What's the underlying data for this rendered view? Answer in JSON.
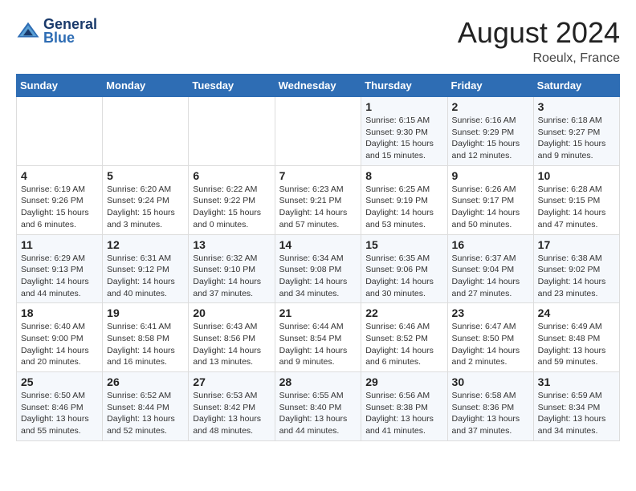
{
  "header": {
    "logo_line1": "General",
    "logo_line2": "Blue",
    "main_title": "August 2024",
    "subtitle": "Roeulx, France"
  },
  "days_of_week": [
    "Sunday",
    "Monday",
    "Tuesday",
    "Wednesday",
    "Thursday",
    "Friday",
    "Saturday"
  ],
  "weeks": [
    [
      {
        "day": "",
        "info": ""
      },
      {
        "day": "",
        "info": ""
      },
      {
        "day": "",
        "info": ""
      },
      {
        "day": "",
        "info": ""
      },
      {
        "day": "1",
        "info": "Sunrise: 6:15 AM\nSunset: 9:30 PM\nDaylight: 15 hours\nand 15 minutes."
      },
      {
        "day": "2",
        "info": "Sunrise: 6:16 AM\nSunset: 9:29 PM\nDaylight: 15 hours\nand 12 minutes."
      },
      {
        "day": "3",
        "info": "Sunrise: 6:18 AM\nSunset: 9:27 PM\nDaylight: 15 hours\nand 9 minutes."
      }
    ],
    [
      {
        "day": "4",
        "info": "Sunrise: 6:19 AM\nSunset: 9:26 PM\nDaylight: 15 hours\nand 6 minutes."
      },
      {
        "day": "5",
        "info": "Sunrise: 6:20 AM\nSunset: 9:24 PM\nDaylight: 15 hours\nand 3 minutes."
      },
      {
        "day": "6",
        "info": "Sunrise: 6:22 AM\nSunset: 9:22 PM\nDaylight: 15 hours\nand 0 minutes."
      },
      {
        "day": "7",
        "info": "Sunrise: 6:23 AM\nSunset: 9:21 PM\nDaylight: 14 hours\nand 57 minutes."
      },
      {
        "day": "8",
        "info": "Sunrise: 6:25 AM\nSunset: 9:19 PM\nDaylight: 14 hours\nand 53 minutes."
      },
      {
        "day": "9",
        "info": "Sunrise: 6:26 AM\nSunset: 9:17 PM\nDaylight: 14 hours\nand 50 minutes."
      },
      {
        "day": "10",
        "info": "Sunrise: 6:28 AM\nSunset: 9:15 PM\nDaylight: 14 hours\nand 47 minutes."
      }
    ],
    [
      {
        "day": "11",
        "info": "Sunrise: 6:29 AM\nSunset: 9:13 PM\nDaylight: 14 hours\nand 44 minutes."
      },
      {
        "day": "12",
        "info": "Sunrise: 6:31 AM\nSunset: 9:12 PM\nDaylight: 14 hours\nand 40 minutes."
      },
      {
        "day": "13",
        "info": "Sunrise: 6:32 AM\nSunset: 9:10 PM\nDaylight: 14 hours\nand 37 minutes."
      },
      {
        "day": "14",
        "info": "Sunrise: 6:34 AM\nSunset: 9:08 PM\nDaylight: 14 hours\nand 34 minutes."
      },
      {
        "day": "15",
        "info": "Sunrise: 6:35 AM\nSunset: 9:06 PM\nDaylight: 14 hours\nand 30 minutes."
      },
      {
        "day": "16",
        "info": "Sunrise: 6:37 AM\nSunset: 9:04 PM\nDaylight: 14 hours\nand 27 minutes."
      },
      {
        "day": "17",
        "info": "Sunrise: 6:38 AM\nSunset: 9:02 PM\nDaylight: 14 hours\nand 23 minutes."
      }
    ],
    [
      {
        "day": "18",
        "info": "Sunrise: 6:40 AM\nSunset: 9:00 PM\nDaylight: 14 hours\nand 20 minutes."
      },
      {
        "day": "19",
        "info": "Sunrise: 6:41 AM\nSunset: 8:58 PM\nDaylight: 14 hours\nand 16 minutes."
      },
      {
        "day": "20",
        "info": "Sunrise: 6:43 AM\nSunset: 8:56 PM\nDaylight: 14 hours\nand 13 minutes."
      },
      {
        "day": "21",
        "info": "Sunrise: 6:44 AM\nSunset: 8:54 PM\nDaylight: 14 hours\nand 9 minutes."
      },
      {
        "day": "22",
        "info": "Sunrise: 6:46 AM\nSunset: 8:52 PM\nDaylight: 14 hours\nand 6 minutes."
      },
      {
        "day": "23",
        "info": "Sunrise: 6:47 AM\nSunset: 8:50 PM\nDaylight: 14 hours\nand 2 minutes."
      },
      {
        "day": "24",
        "info": "Sunrise: 6:49 AM\nSunset: 8:48 PM\nDaylight: 13 hours\nand 59 minutes."
      }
    ],
    [
      {
        "day": "25",
        "info": "Sunrise: 6:50 AM\nSunset: 8:46 PM\nDaylight: 13 hours\nand 55 minutes."
      },
      {
        "day": "26",
        "info": "Sunrise: 6:52 AM\nSunset: 8:44 PM\nDaylight: 13 hours\nand 52 minutes."
      },
      {
        "day": "27",
        "info": "Sunrise: 6:53 AM\nSunset: 8:42 PM\nDaylight: 13 hours\nand 48 minutes."
      },
      {
        "day": "28",
        "info": "Sunrise: 6:55 AM\nSunset: 8:40 PM\nDaylight: 13 hours\nand 44 minutes."
      },
      {
        "day": "29",
        "info": "Sunrise: 6:56 AM\nSunset: 8:38 PM\nDaylight: 13 hours\nand 41 minutes."
      },
      {
        "day": "30",
        "info": "Sunrise: 6:58 AM\nSunset: 8:36 PM\nDaylight: 13 hours\nand 37 minutes."
      },
      {
        "day": "31",
        "info": "Sunrise: 6:59 AM\nSunset: 8:34 PM\nDaylight: 13 hours\nand 34 minutes."
      }
    ]
  ]
}
